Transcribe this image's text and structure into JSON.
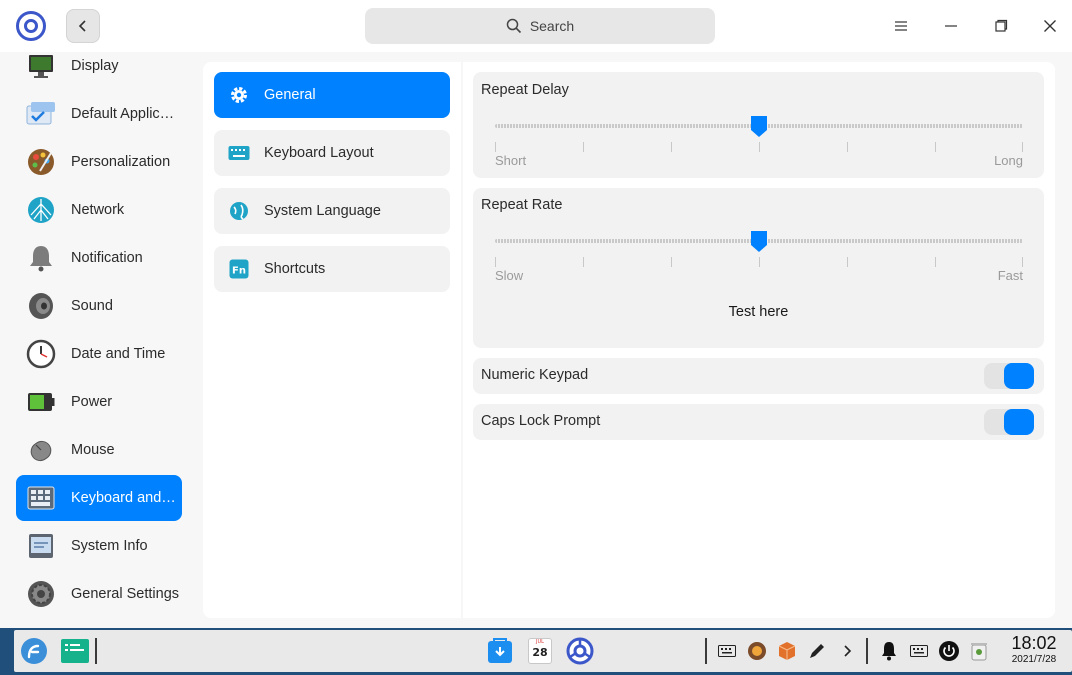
{
  "titlebar": {
    "search_placeholder": "Search"
  },
  "sidebar": {
    "items": [
      {
        "label": "Display",
        "icon": "display-icon"
      },
      {
        "label": "Default Applications",
        "icon": "default-apps-icon"
      },
      {
        "label": "Personalization",
        "icon": "personalization-icon"
      },
      {
        "label": "Network",
        "icon": "network-icon"
      },
      {
        "label": "Notification",
        "icon": "notification-icon"
      },
      {
        "label": "Sound",
        "icon": "sound-icon"
      },
      {
        "label": "Date and Time",
        "icon": "clock-icon"
      },
      {
        "label": "Power",
        "icon": "battery-icon"
      },
      {
        "label": "Mouse",
        "icon": "mouse-icon"
      },
      {
        "label": "Keyboard and Language",
        "icon": "keyboard-icon",
        "active": true
      },
      {
        "label": "System Info",
        "icon": "system-info-icon"
      },
      {
        "label": "General Settings",
        "icon": "general-settings-icon"
      }
    ]
  },
  "subnav": {
    "items": [
      {
        "label": "General",
        "icon": "gear-icon",
        "active": true
      },
      {
        "label": "Keyboard Layout",
        "icon": "keyboard-layout-icon"
      },
      {
        "label": "System Language",
        "icon": "globe-icon"
      },
      {
        "label": "Shortcuts",
        "icon": "fn-icon"
      }
    ]
  },
  "settings": {
    "repeat_delay": {
      "title": "Repeat Delay",
      "min_label": "Short",
      "max_label": "Long",
      "value": 0.5
    },
    "repeat_rate": {
      "title": "Repeat Rate",
      "min_label": "Slow",
      "max_label": "Fast",
      "value": 0.5
    },
    "test_label": "Test here",
    "numeric_keypad": {
      "label": "Numeric Keypad",
      "on": true
    },
    "caps_lock_prompt": {
      "label": "Caps Lock Prompt",
      "on": true
    }
  },
  "taskbar": {
    "calendar_day": "28",
    "calendar_month": "JUL",
    "clock_time": "18:02",
    "clock_date": "2021/7/28"
  },
  "colors": {
    "accent": "#0081ff"
  }
}
